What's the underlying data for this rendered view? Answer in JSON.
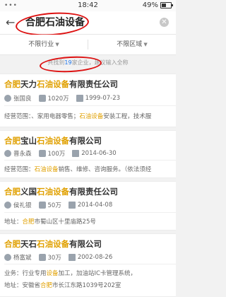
{
  "status_bar": {
    "left": "•••",
    "time": "18:42",
    "battery": "49%",
    "battery_level": 0.49
  },
  "search": {
    "back_icon": "back-arrow-icon",
    "query": "合肥石油设备",
    "clear_icon": "clear-icon"
  },
  "filters": {
    "industry": "不限行业",
    "region": "不限区域"
  },
  "result_tip": {
    "prefix": "共找到",
    "count": "19",
    "suffix": "家企业，建议输入全称"
  },
  "results": [
    {
      "name_parts": [
        "合肥",
        "天力",
        "石油设备",
        "有限责任公司"
      ],
      "legal_person": "张国良",
      "capital": "1020万",
      "date": "1999-07-23",
      "extra_label": "经营范围：",
      "extra_text": "、家用电器零售；",
      "extra_hl": "石油设备",
      "extra_tail": "安装工程，技术服"
    },
    {
      "name_parts": [
        "合肥",
        "宝山",
        "石油设备",
        "有限公司"
      ],
      "legal_person": "晋永森",
      "capital": "100万",
      "date": "2014-06-30",
      "extra_label": "经营范围：",
      "extra_text": "",
      "extra_hl": "石油设备",
      "extra_tail": "销售、维修、咨询服务。（依法须经"
    },
    {
      "name_parts": [
        "合肥",
        "义国",
        "石油设备",
        "有限责任公司"
      ],
      "legal_person": "侯礼银",
      "capital": "50万",
      "date": "2014-04-08",
      "extra_label": "地址：",
      "extra_text": "",
      "extra_hl": "合肥",
      "extra_tail": "市蜀山区十里庙路25号"
    },
    {
      "name_parts": [
        "合肥",
        "天石",
        "石油设备",
        "有限公司"
      ],
      "legal_person": "杨富斌",
      "capital": "30万",
      "date": "2002-08-26",
      "extra_label": "业务：",
      "extra_text": "行业专用",
      "extra_hl": "设备",
      "extra_tail": "加工，加油站IC卡管理系统，",
      "extra2_label": "地址：",
      "extra2_text": "安徽省",
      "extra2_hl": "合肥",
      "extra2_tail": "市长江东路1039号202室"
    }
  ]
}
